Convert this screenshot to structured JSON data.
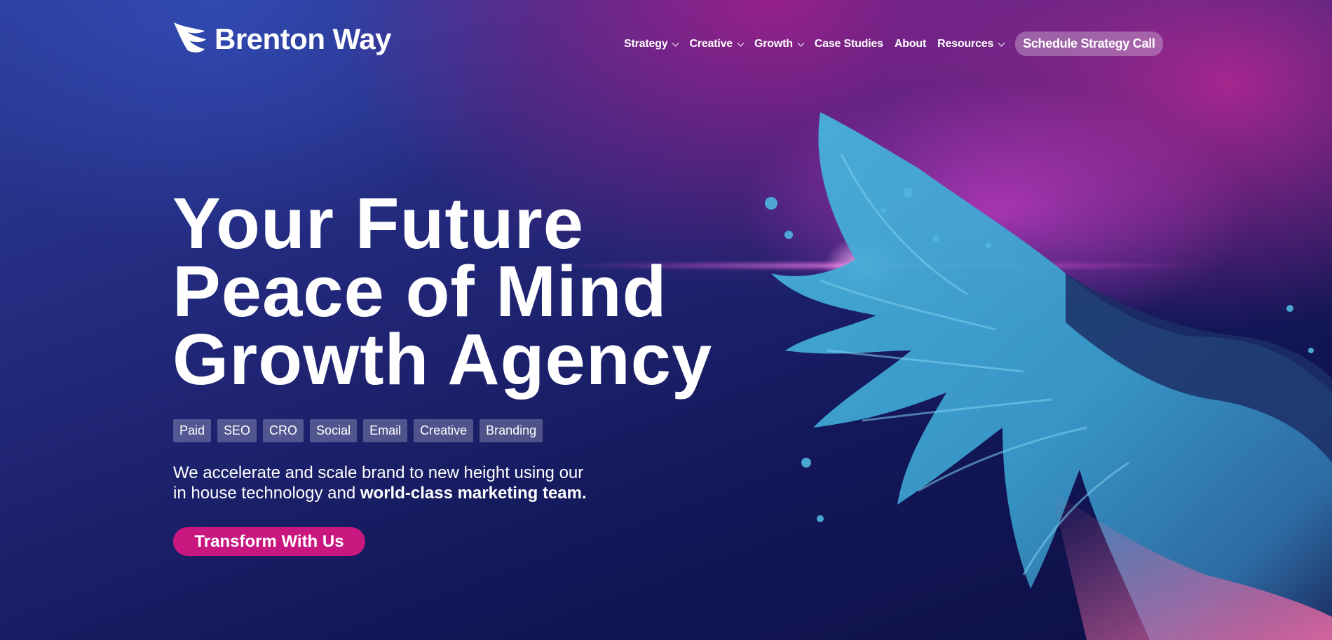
{
  "header": {
    "brand": "Brenton Way",
    "logo_icon": "wing-logo-icon"
  },
  "nav": {
    "items": [
      {
        "label": "Strategy",
        "has_dropdown": true
      },
      {
        "label": "Creative",
        "has_dropdown": true
      },
      {
        "label": "Growth",
        "has_dropdown": true
      },
      {
        "label": "Case Studies",
        "has_dropdown": false
      },
      {
        "label": "About",
        "has_dropdown": false
      },
      {
        "label": "Resources",
        "has_dropdown": true
      }
    ],
    "cta_label": "Schedule Strategy Call"
  },
  "hero": {
    "headline_lines": [
      "Your Future",
      "Peace of Mind",
      "Growth Agency"
    ],
    "tags": [
      "Paid",
      "SEO",
      "CRO",
      "Social",
      "Email",
      "Creative",
      "Branding"
    ],
    "description_line1": "We accelerate and scale brand to new height using our",
    "description_line2_plain": "in house technology and ",
    "description_line2_bold": "world-class marketing team.",
    "cta_label": "Transform With Us"
  },
  "colors": {
    "cta_main": "#c8177f",
    "background_dark": "#121656",
    "background_magenta": "#aa1e8c",
    "wing_cyan": "#3ea6d2",
    "wing_pink": "#e05a9a"
  }
}
